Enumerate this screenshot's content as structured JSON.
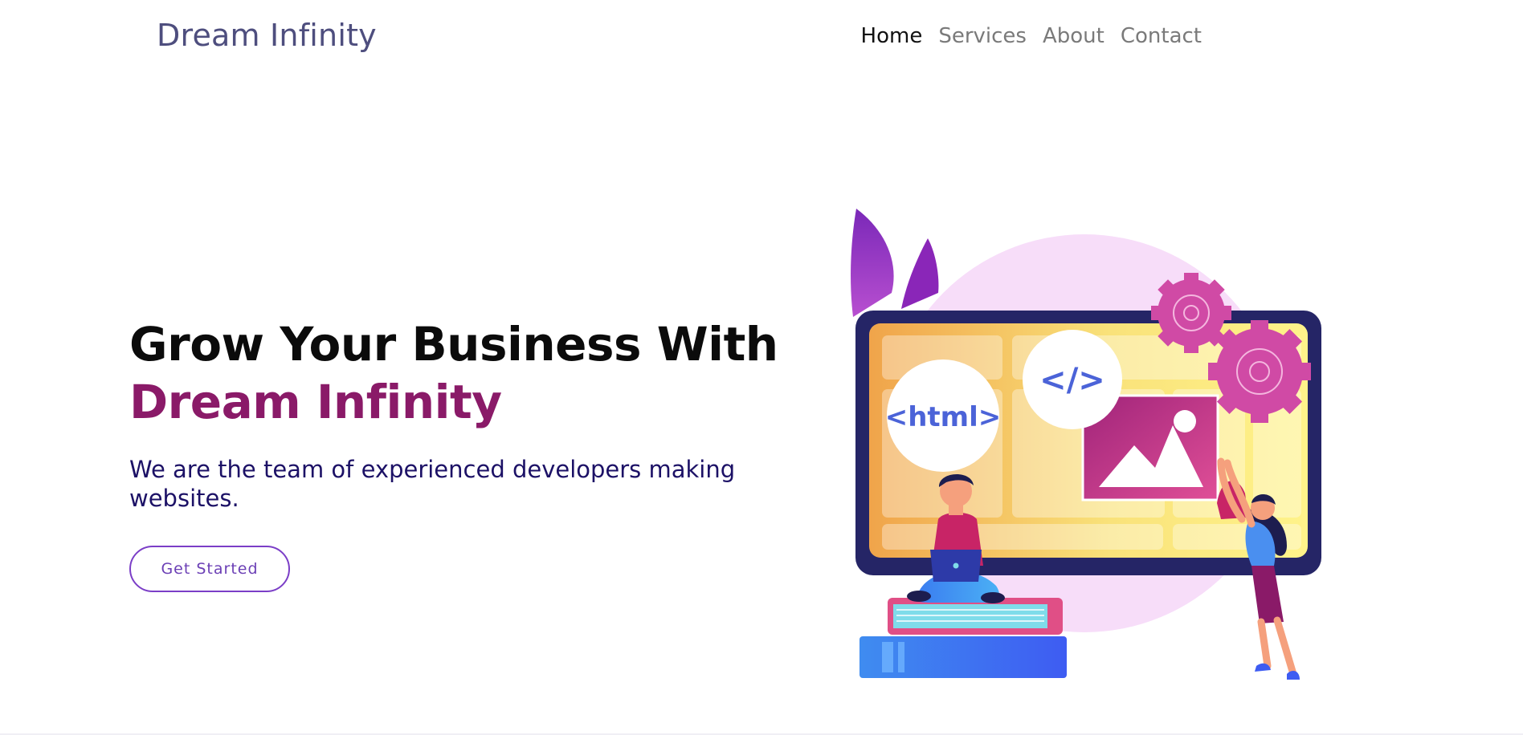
{
  "nav": {
    "brand": "Dream Infinity",
    "links": [
      {
        "label": "Home",
        "active": true
      },
      {
        "label": "Services",
        "active": false
      },
      {
        "label": "About",
        "active": false
      },
      {
        "label": "Contact",
        "active": false
      }
    ]
  },
  "hero": {
    "title_line1": "Grow Your Business With",
    "title_line2": "Dream Infinity",
    "subtitle": "We are the team of experienced developers making websites.",
    "cta_label": "Get Started"
  },
  "illustration": {
    "html_tag": "<html>",
    "code_tag": "</>"
  },
  "colors": {
    "brand_text": "#4e4e7e",
    "accent": "#8a1a68",
    "subtitle": "#1c1166",
    "button_border": "#7b3ec7"
  }
}
